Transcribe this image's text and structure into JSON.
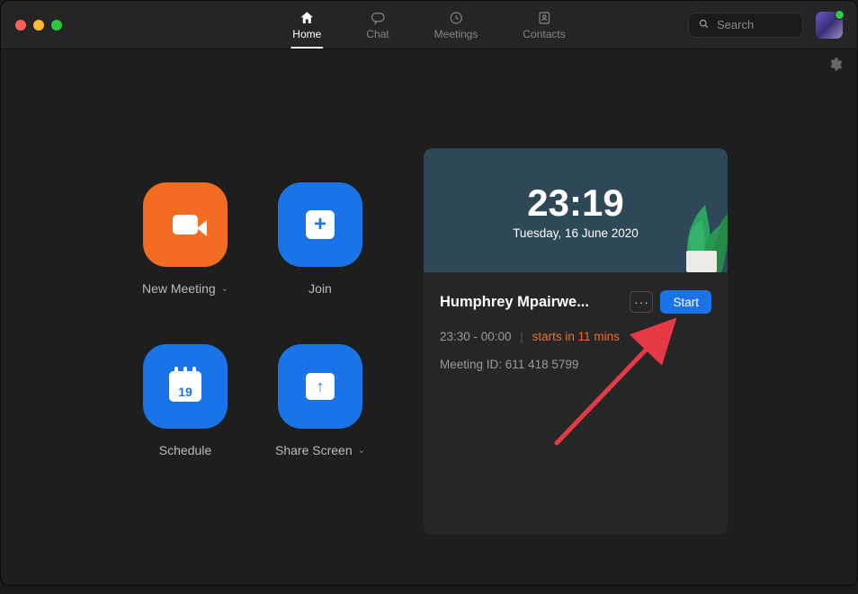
{
  "nav": {
    "tabs": [
      {
        "id": "home",
        "label": "Home",
        "active": true
      },
      {
        "id": "chat",
        "label": "Chat",
        "active": false
      },
      {
        "id": "meetings",
        "label": "Meetings",
        "active": false
      },
      {
        "id": "contacts",
        "label": "Contacts",
        "active": false
      }
    ]
  },
  "search": {
    "placeholder": "Search"
  },
  "actions": {
    "new_meeting": {
      "label": "New Meeting"
    },
    "join": {
      "label": "Join"
    },
    "schedule": {
      "label": "Schedule",
      "calendar_day": "19"
    },
    "share_screen": {
      "label": "Share Screen"
    }
  },
  "clock": {
    "time": "23:19",
    "date": "Tuesday, 16 June 2020"
  },
  "upcoming": {
    "title": "Humphrey Mpairwe...",
    "time_range": "23:30 - 00:00",
    "starts_in": "starts in 11 mins",
    "meeting_id_label": "Meeting ID:",
    "meeting_id": "611 418 5799",
    "start_label": "Start"
  },
  "colors": {
    "accent_orange": "#f26d21",
    "accent_blue": "#1b73e8",
    "bg": "#1e1e1e",
    "card": "#262626"
  }
}
